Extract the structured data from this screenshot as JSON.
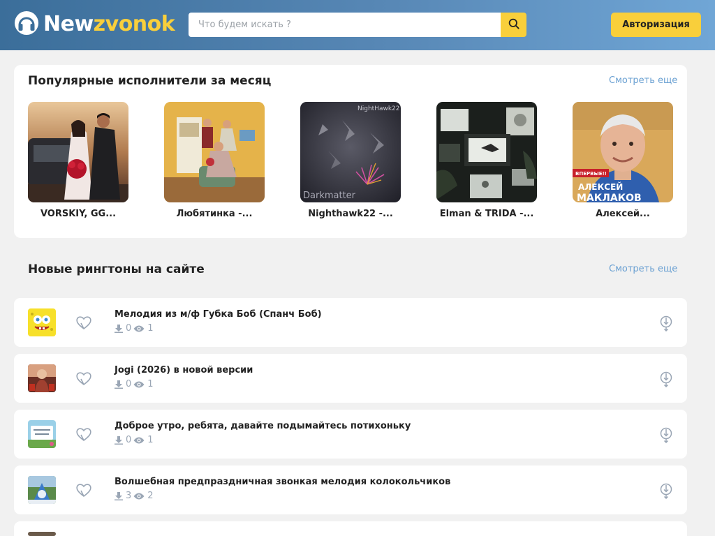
{
  "header": {
    "logo_part1": "New",
    "logo_part2": "zvonok",
    "search_placeholder": "Что будем искать ?",
    "auth_label": "Авторизация"
  },
  "popular": {
    "title": "Популярные исполнители за месяц",
    "see_more": "Смотреть еще",
    "artists": [
      {
        "name": "VORSKIY, GG..."
      },
      {
        "name": "Любятинка -..."
      },
      {
        "name": "Nighthawk22 -..."
      },
      {
        "name": "Elman & TRIDA -..."
      },
      {
        "name": "Алексей..."
      }
    ],
    "cover_texts": {
      "nighthawk_watermark": "NightHawk22",
      "nighthawk_caption": "Darkmatter",
      "maklakov_badge": "ВПЕРВЫЕ!!",
      "maklakov_line1": "АЛЕКСЕЙ",
      "maklakov_line2": "МАКЛАКОВ"
    }
  },
  "ringtones": {
    "title": "Новые рингтоны на сайте",
    "see_more": "Смотреть еще",
    "items": [
      {
        "title": "Мелодия из м/ф Губка Боб (Спанч Боб)",
        "downloads": "0",
        "views": "1"
      },
      {
        "title": "Jogi (2026) в новой версии",
        "downloads": "0",
        "views": "1"
      },
      {
        "title": "Доброе утро, ребята, давайте подымайтесь потихоньку",
        "downloads": "0",
        "views": "1"
      },
      {
        "title": "Волшебная предпраздничная звонкая мелодия колокольчиков",
        "downloads": "3",
        "views": "2"
      }
    ]
  },
  "colors": {
    "accent_yellow": "#f9cf3b",
    "link_blue": "#6aa0d2",
    "stat_grey": "#9aa6b5"
  }
}
